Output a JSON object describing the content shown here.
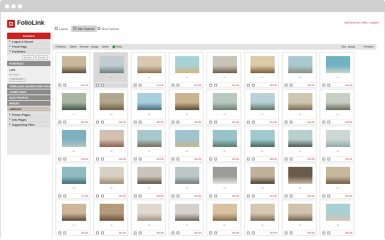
{
  "app": {
    "name": "FolioLink"
  },
  "header": {
    "links": [
      "My Account",
      "Help",
      "Logout"
    ],
    "tabs": [
      {
        "label": "Layout",
        "icon": "layout-icon"
      },
      {
        "label": "Site Content",
        "icon": "content-icon",
        "active": true
      },
      {
        "label": "More Options",
        "icon": "options-icon"
      }
    ]
  },
  "sidebar": {
    "header": "Sections",
    "sections": [
      {
        "label": "Logos & Sound"
      },
      {
        "label": "Front Page"
      },
      {
        "label": "Portfolios"
      }
    ],
    "portfolio_buttons": [
      "Reorder",
      "Portfolio"
    ],
    "folders": [
      {
        "label": "PORTRAIT"
      },
      {
        "label": "LIFE",
        "sub": "83 images",
        "edit": "Edit Portfolio",
        "open": true
      },
      {
        "label": "THRILLING ADVENTURE HOUR"
      },
      {
        "label": "CLIRE PANS"
      },
      {
        "label": "DOG PEOPLE"
      },
      {
        "label": "BRAZIL"
      },
      {
        "label": "LIBRARY",
        "selected": true
      }
    ],
    "sections_after": [
      {
        "label": "Promo Pages"
      },
      {
        "label": "Info Pages"
      },
      {
        "label": "Supporting Files"
      }
    ]
  },
  "toolbar": {
    "items": [
      "Portfolios",
      "Select",
      "Reorder",
      "Assign",
      "Delete",
      "FAQs"
    ],
    "size_label": "Size",
    "preview_label": "Preview"
  },
  "colors": {
    "accent": "#cc1f1f",
    "help": "#2a9a3c"
  },
  "tiles": [
    {
      "num": "9",
      "badge": "616×39",
      "c1": "#c9b89a",
      "c2": "#5a4b3a"
    },
    {
      "num": "10",
      "badge": "",
      "c1": "#bfcdd0",
      "c2": "#6d7d80",
      "hl": true
    },
    {
      "num": "11",
      "badge": "411×30",
      "c1": "#d9c8b0",
      "c2": "#8a7356"
    },
    {
      "num": "12",
      "badge": "391×88",
      "c1": "#a6d2d8",
      "c2": "#d9b37a"
    },
    {
      "num": "13",
      "badge": "396×88",
      "c1": "#c8c3b6",
      "c2": "#6b5d4b"
    },
    {
      "num": "14",
      "badge": "395×88",
      "c1": "#dcc9a6",
      "c2": "#7a5d3d"
    },
    {
      "num": "15",
      "badge": "390×38",
      "c1": "#aac8cf",
      "c2": "#8a8f7f"
    },
    {
      "num": "16",
      "badge": "396×88",
      "c1": "#6fb2c4",
      "c2": "#c9d6c4"
    },
    {
      "num": "17",
      "badge": "386×88",
      "c1": "#a9b6a2",
      "c2": "#3e5744"
    },
    {
      "num": "18",
      "badge": "396×38",
      "c1": "#b3a68f",
      "c2": "#6d5c44"
    },
    {
      "num": "19",
      "badge": "385×88",
      "c1": "#a6cfe0",
      "c2": "#4a6b7a"
    },
    {
      "num": "20",
      "badge": "396×88",
      "c1": "#c9b48f",
      "c2": "#5b4631"
    },
    {
      "num": "21",
      "badge": "396×88",
      "c1": "#b8c8c0",
      "c2": "#6a7f70"
    },
    {
      "num": "22",
      "badge": "391×88",
      "c1": "#b8d1d6",
      "c2": "#5c6f60"
    },
    {
      "num": "23",
      "badge": "396×88",
      "c1": "#cfc6b1",
      "c2": "#7b6b52"
    },
    {
      "num": "24",
      "badge": "396×88",
      "c1": "#c6cfc1",
      "c2": "#6a6a5a"
    },
    {
      "num": "25",
      "badge": "395×88",
      "c1": "#7fb0c0",
      "c2": "#b4c7c4"
    },
    {
      "num": "26",
      "badge": "396×88",
      "c1": "#d2c0b0",
      "c2": "#8f5c4a"
    },
    {
      "num": "27",
      "badge": "396×88",
      "c1": "#a7c8cc",
      "c2": "#7c6a52"
    },
    {
      "num": "28",
      "badge": "396×88",
      "c1": "#a0c4cc",
      "c2": "#c7b48f"
    },
    {
      "num": "29",
      "badge": "396×88",
      "c1": "#97c4c9",
      "c2": "#567a6a"
    },
    {
      "num": "30",
      "badge": "388×88",
      "c1": "#9fcbd0",
      "c2": "#446657"
    },
    {
      "num": "31",
      "badge": "396×88",
      "c1": "#b7d0cf",
      "c2": "#4e5a50"
    },
    {
      "num": "32",
      "badge": "396×38",
      "c1": "#cdd7d6",
      "c2": "#8fa8a6"
    },
    {
      "num": "33",
      "badge": "371×88",
      "c1": "#8fbcc2",
      "c2": "#3f6b72"
    },
    {
      "num": "34",
      "badge": "396×88",
      "c1": "#d8d0c3",
      "c2": "#9a8a72"
    },
    {
      "num": "35",
      "badge": "396×88",
      "c1": "#c9c3b9",
      "c2": "#5a5046"
    },
    {
      "num": "36",
      "badge": "396×88",
      "c1": "#bcc7c8",
      "c2": "#6f7a7b"
    },
    {
      "num": "37",
      "badge": "396×88",
      "c1": "#9c9c98",
      "c2": "#e5e3dc"
    },
    {
      "num": "38",
      "badge": "396×88",
      "c1": "#c0b29a",
      "c2": "#4a3f32"
    },
    {
      "num": "39",
      "badge": "396×88",
      "c1": "#6a5c4a",
      "c2": "#c8b8a0"
    },
    {
      "num": "40",
      "badge": "396×88",
      "c1": "#c7b79b",
      "c2": "#6b5a44"
    },
    {
      "num": "41",
      "badge": "396×88",
      "c1": "#cdb79a",
      "c2": "#5c4a36"
    },
    {
      "num": "42",
      "badge": "396×88",
      "c1": "#b29a7a",
      "c2": "#6e5238"
    },
    {
      "num": "43",
      "badge": "396×88",
      "c1": "#e1d9cf",
      "c2": "#a29480"
    },
    {
      "num": "44",
      "badge": "396×88",
      "c1": "#d6d2cb",
      "c2": "#6c6358"
    },
    {
      "num": "45",
      "badge": "396×88",
      "c1": "#d8c2a0",
      "c2": "#8a6a45"
    },
    {
      "num": "46",
      "badge": "396×88",
      "c1": "#d6c8b3",
      "c2": "#7c6b55"
    },
    {
      "num": "47",
      "badge": "396×88",
      "c1": "#d1c3ae",
      "c2": "#6f624e"
    },
    {
      "num": "48",
      "badge": "396×88",
      "c1": "#a9d0d3",
      "c2": "#d2c8ae"
    }
  ]
}
